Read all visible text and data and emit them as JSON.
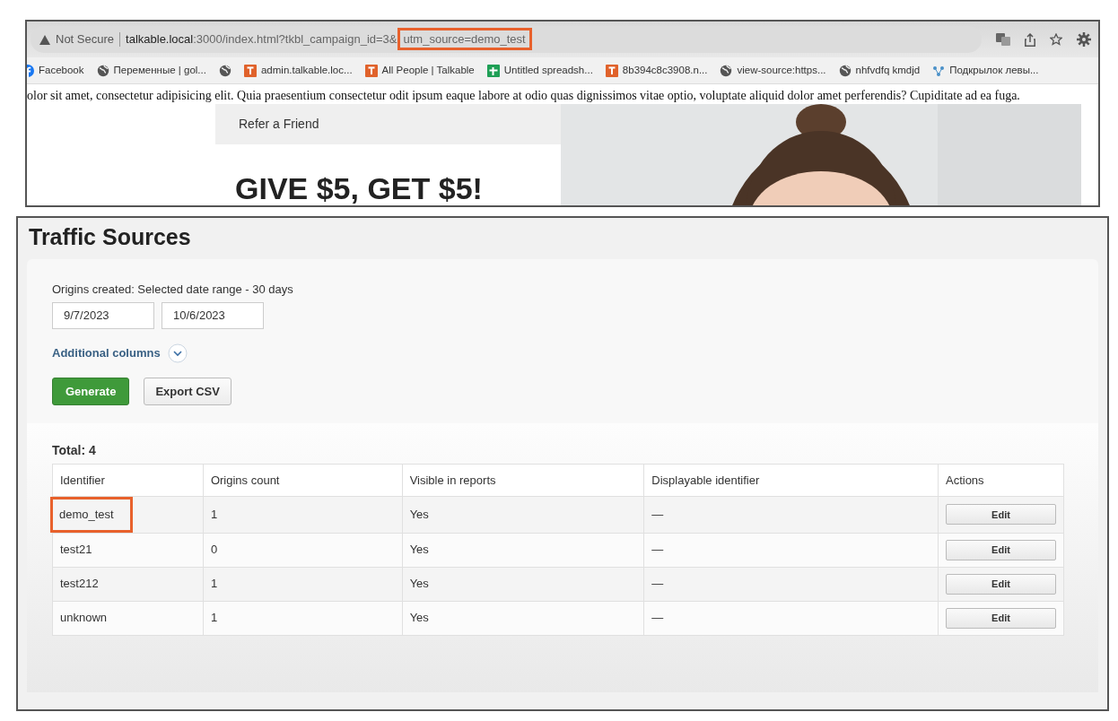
{
  "browser": {
    "security_label": "Not Secure",
    "url_parts": [
      {
        "text": "talkable.local",
        "kind": "host",
        "highlighted": false
      },
      {
        "text": ":3000/index.html?tkbl_campaign_id=3&",
        "kind": "path",
        "highlighted": false
      },
      {
        "text": "utm_source=demo_test",
        "kind": "path",
        "highlighted": true
      }
    ],
    "bookmarks": [
      {
        "label": "Facebook",
        "kind": "facebook"
      },
      {
        "label": "Переменные | gol...",
        "kind": "globe"
      },
      {
        "kind": "globe"
      },
      {
        "label": "admin.talkable.loc...",
        "kind": "talkable"
      },
      {
        "label": "All People | Talkable",
        "kind": "talkable"
      },
      {
        "label": "Untitled spreadsh...",
        "kind": "sheet"
      },
      {
        "label": "8b394c8c3908.n...",
        "kind": "talkable"
      },
      {
        "label": "view-source:https...",
        "kind": "globe"
      },
      {
        "label": "nhfvdfq kmdjd",
        "kind": "globe"
      },
      {
        "label": "Подкрылок левы...",
        "kind": "network"
      }
    ]
  },
  "page": {
    "body_text": "olor sit amet, consectetur adipisicing elit. Quia praesentium consectetur odit ipsum eaque labore at odio quas dignissimos vitae optio, voluptate aliquid dolor amet perferendis? Cupiditate ad ea fuga.",
    "offer_header": "Refer a Friend",
    "offer_title": "GIVE $5, GET $5!"
  },
  "report": {
    "title": "Traffic Sources",
    "date_label": "Origins created: Selected date range - 30 days",
    "date_from": "9/7/2023",
    "date_to": "10/6/2023",
    "additional_columns": "Additional columns",
    "expanded": false,
    "buttons": [
      {
        "label": "Generate",
        "kind": "primary"
      },
      {
        "label": "Export CSV",
        "kind": "secondary"
      }
    ],
    "total": "Total: 4",
    "table": {
      "columns": [
        "Identifier",
        "Origins count",
        "Visible in reports",
        "Displayable identifier",
        "Actions"
      ],
      "rows": [
        {
          "identifier": "demo_test",
          "origins_count": "1",
          "visible": "Yes",
          "displayable": "—",
          "action": "Edit",
          "highlighted": true
        },
        {
          "identifier": "test21",
          "origins_count": "0",
          "visible": "Yes",
          "displayable": "—",
          "action": "Edit",
          "highlighted": false
        },
        {
          "identifier": "test212",
          "origins_count": "1",
          "visible": "Yes",
          "displayable": "—",
          "action": "Edit",
          "highlighted": false
        },
        {
          "identifier": "unknown",
          "origins_count": "1",
          "visible": "Yes",
          "displayable": "—",
          "action": "Edit",
          "highlighted": false
        }
      ]
    }
  }
}
